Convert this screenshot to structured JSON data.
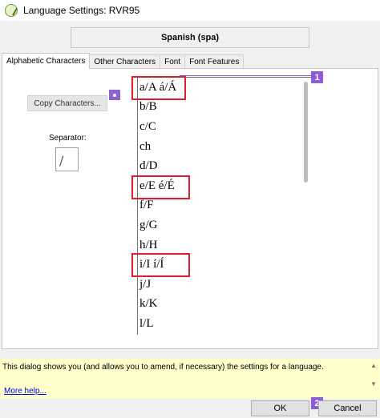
{
  "window": {
    "title": "Language Settings: RVR95",
    "icon": "app-logo-icon"
  },
  "language": {
    "name": "Spanish (spa)"
  },
  "tabs": [
    {
      "label": "Alphabetic Characters",
      "active": true
    },
    {
      "label": "Other Characters",
      "active": false
    },
    {
      "label": "Font",
      "active": false
    },
    {
      "label": "Font Features",
      "active": false
    }
  ],
  "alphabetic": {
    "copy_button_label": "Copy Characters...",
    "separator_label": "Separator:",
    "separator_value": "/",
    "characters": [
      "a/A á/Á",
      "b/B",
      "c/C",
      "ch",
      "d/D",
      "e/E é/É",
      "f/F",
      "g/G",
      "h/H",
      "i/I í/Í",
      "j/J",
      "k/K",
      "l/L"
    ]
  },
  "annotations": {
    "badge_1": "1",
    "badge_2": "2",
    "accent_color": "#8e5cd8",
    "highlight_color": "#e31c2a"
  },
  "info": {
    "text": "This dialog shows you (and allows you to amend, if necessary) the settings for a language.",
    "more_help": "More help...",
    "background_color": "#ffffcc"
  },
  "buttons": {
    "ok": "OK",
    "cancel": "Cancel"
  }
}
